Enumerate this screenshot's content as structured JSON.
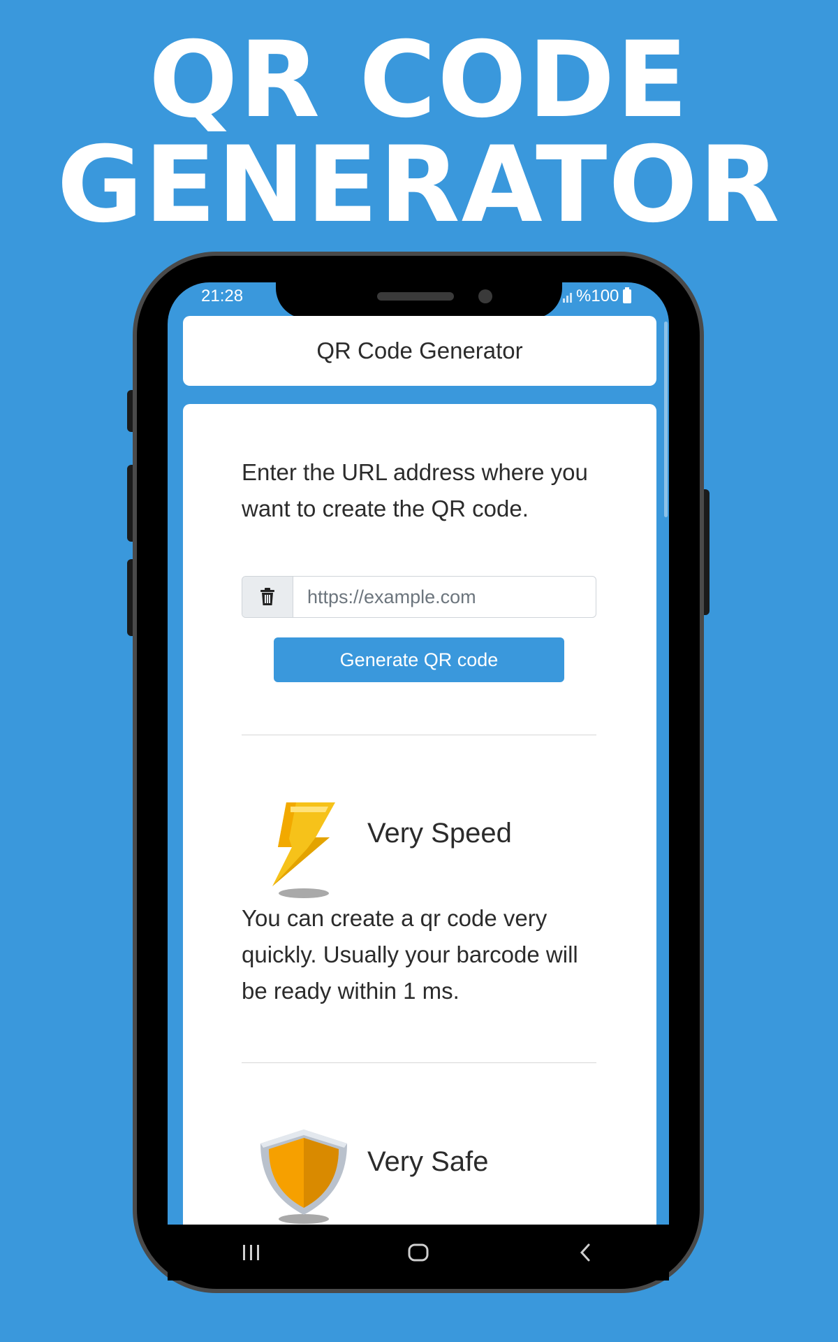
{
  "headline": {
    "line1": "QR CODE",
    "line2": "GENERATOR"
  },
  "status_bar": {
    "time": "21:28",
    "battery": "%100"
  },
  "app": {
    "title": "QR Code Generator",
    "intro_text": "Enter the URL address where you want to create the QR code.",
    "url_input": {
      "value": "",
      "placeholder": "https://example.com"
    },
    "generate_button_label": "Generate QR code"
  },
  "features": [
    {
      "title": "Very Speed",
      "icon": "lightning-icon",
      "description": "You can create a qr code very quickly. Usually your barcode will be ready within 1 ms."
    },
    {
      "title": "Very Safe",
      "icon": "shield-icon",
      "description": ""
    }
  ],
  "nav_bar": {
    "buttons": [
      "recent-apps-icon",
      "home-icon",
      "back-icon"
    ]
  },
  "colors": {
    "background": "#3a98dc",
    "accent": "#3a98dc",
    "card": "#ffffff",
    "text": "#2b2b2b"
  }
}
